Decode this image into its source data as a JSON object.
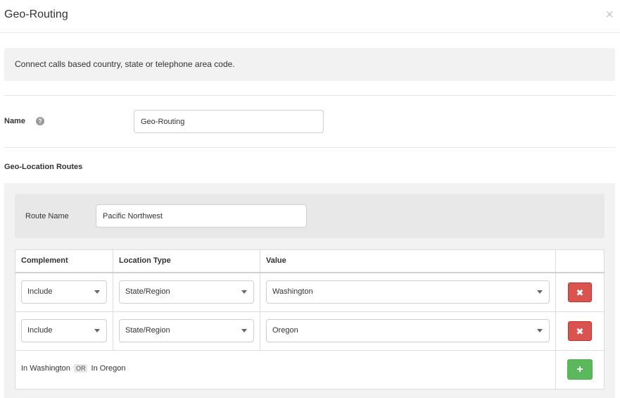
{
  "modal": {
    "title": "Geo-Routing",
    "close_glyph": "×",
    "description": "Connect calls based country, state or telephone area code."
  },
  "name_field": {
    "label": "Name",
    "help_glyph": "?",
    "value": "Geo-Routing"
  },
  "routes": {
    "section_title": "Geo-Location Routes",
    "route_name_label": "Route Name",
    "route_name_value": "Pacific Northwest",
    "columns": [
      "Complement",
      "Location Type",
      "Value",
      ""
    ],
    "rows": [
      {
        "complement": "Include",
        "location_type": "State/Region",
        "value": "Washington",
        "delete_glyph": "✖"
      },
      {
        "complement": "Include",
        "location_type": "State/Region",
        "value": "Oregon",
        "delete_glyph": "✖"
      }
    ],
    "summary": {
      "left": "In Washington",
      "operator": "OR",
      "right": "In Oregon"
    },
    "add_glyph": "+"
  },
  "colors": {
    "delete": "#d9534f",
    "add": "#5cb85c",
    "panel": "#f2f2f2"
  },
  "icons": {
    "close": "close-icon",
    "help": "help-icon",
    "dropdown": "chevron-down-icon",
    "delete": "times-icon",
    "add": "plus-icon"
  }
}
